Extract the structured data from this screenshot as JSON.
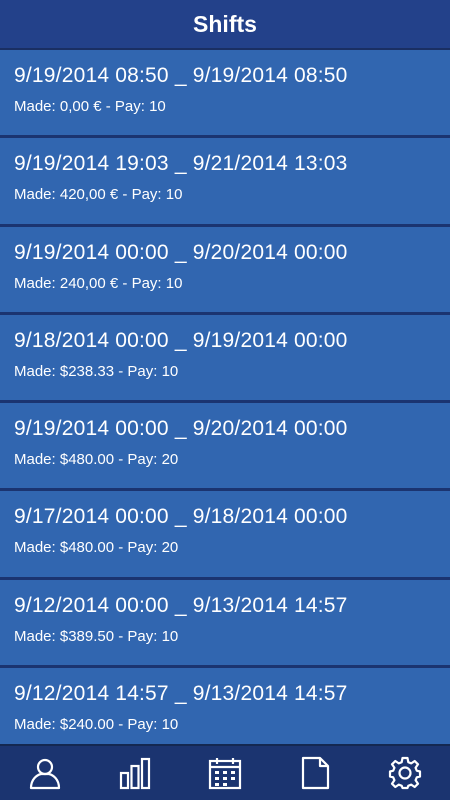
{
  "header": {
    "title": "Shifts"
  },
  "shifts": [
    {
      "range": "9/19/2014 08:50 _ 9/19/2014 08:50",
      "meta": "Made: 0,00 € - Pay: 10"
    },
    {
      "range": "9/19/2014 19:03 _ 9/21/2014 13:03",
      "meta": "Made: 420,00 € - Pay: 10"
    },
    {
      "range": "9/19/2014 00:00 _ 9/20/2014 00:00",
      "meta": "Made: 240,00 € - Pay: 10"
    },
    {
      "range": "9/18/2014 00:00 _ 9/19/2014 00:00",
      "meta": "Made: $238.33 - Pay: 10"
    },
    {
      "range": "9/19/2014 00:00 _ 9/20/2014 00:00",
      "meta": "Made: $480.00 - Pay: 20"
    },
    {
      "range": "9/17/2014 00:00 _ 9/18/2014 00:00",
      "meta": "Made: $480.00 - Pay: 20"
    },
    {
      "range": "9/12/2014 00:00 _ 9/13/2014 14:57",
      "meta": "Made: $389.50 - Pay: 10"
    },
    {
      "range": "9/12/2014 14:57 _ 9/13/2014 14:57",
      "meta": "Made: $240.00 - Pay: 10"
    }
  ],
  "tabbar": {
    "icons": [
      "profile-icon",
      "stats-icon",
      "calendar-icon",
      "document-icon",
      "gear-icon"
    ]
  }
}
